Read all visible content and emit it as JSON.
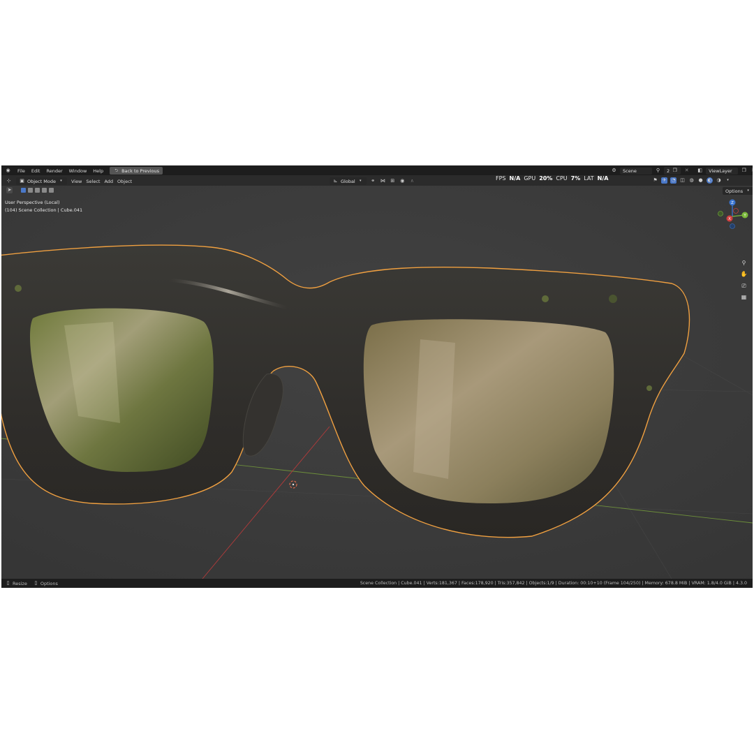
{
  "menu": {
    "logo_icon": "blender-logo-icon",
    "items": [
      "File",
      "Edit",
      "Render",
      "Window",
      "Help"
    ],
    "back_button": "Back to Previous"
  },
  "scene": {
    "label": "Scene",
    "count": "2",
    "view_layer": "ViewLayer"
  },
  "header": {
    "mode": "Object Mode",
    "menus": [
      "View",
      "Select",
      "Add",
      "Object"
    ],
    "orientation": "Global",
    "options_label": "Options"
  },
  "stats": {
    "fps_label": "FPS",
    "fps_value": "N/A",
    "gpu_label": "GPU",
    "gpu_value": "20%",
    "cpu_label": "CPU",
    "cpu_value": "7%",
    "lat_label": "LAT",
    "lat_value": "N/A"
  },
  "viewport": {
    "perspective": "User Perspective (Local)",
    "collection": "(104) Scene Collection | Cube.041",
    "selection_color": "#f0a040",
    "gizmo": {
      "z": "Z",
      "y": "Y",
      "x": "X"
    }
  },
  "statusbar": {
    "left": [
      "Resize",
      "Options"
    ],
    "info": "Scene Collection | Cube.041 | Verts:181,367 | Faces:178,920 | Tris:357,842 | Objects:1/9 | Duration: 00:10+10 (Frame 104/250) | Memory: 678.8 MiB | VRAM: 1.8/4.0 GiB | 4.3.0"
  }
}
